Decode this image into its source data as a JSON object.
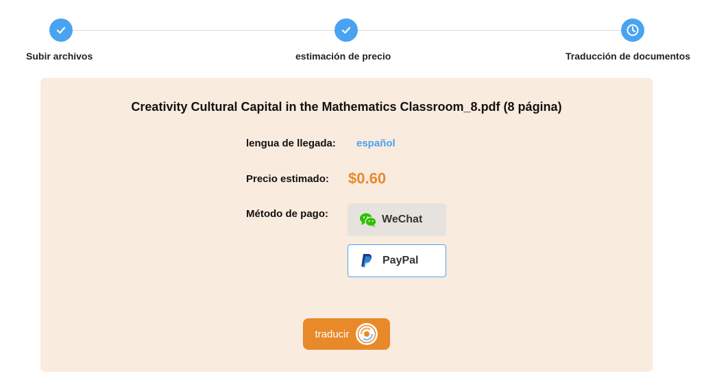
{
  "steps": [
    {
      "label": "Subir archivos",
      "status": "done"
    },
    {
      "label": "estimación de precio",
      "status": "done"
    },
    {
      "label": "Traducción de documentos",
      "status": "current"
    }
  ],
  "colors": {
    "accent_blue": "#4aa3f0",
    "accent_orange": "#e8892a",
    "card_bg": "#faebdf",
    "wechat_green": "#2dc100",
    "paypal_navy": "#1c3a8c"
  },
  "file": {
    "title": "Creativity Cultural Capital in the Mathematics Classroom_8.pdf (8 página)"
  },
  "target_language": {
    "label": "lengua de llegada:",
    "value": "español"
  },
  "price": {
    "label": "Precio estimado:",
    "value": "$0.60"
  },
  "payment": {
    "label": "Método de pago:",
    "options": [
      {
        "label": "WeChat",
        "icon": "wechat-icon",
        "selected": false
      },
      {
        "label": "PayPal",
        "icon": "paypal-icon",
        "selected": true
      }
    ]
  },
  "translate_button": {
    "label": "traducir",
    "icon": "translate-icon"
  }
}
